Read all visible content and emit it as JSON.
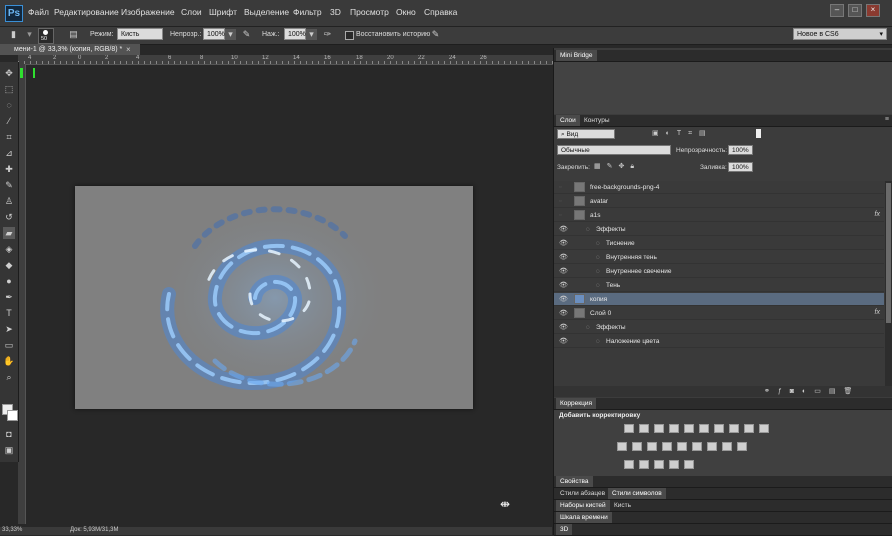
{
  "app": {
    "logo": "Ps",
    "menu": [
      "Файл",
      "Редактирование",
      "Изображение",
      "Слои",
      "Шрифт",
      "Выделение",
      "Фильтр",
      "3D",
      "Просмотр",
      "Окно",
      "Справка"
    ],
    "window_buttons": [
      "–",
      "□",
      "×"
    ]
  },
  "options_bar": {
    "brush_size": "50",
    "mode_label": "Режим:",
    "mode_value": "Кисть",
    "opacity_label": "Непрозр.:",
    "opacity_value": "100%",
    "pressure_label": "Наж.:",
    "pressure_value": "100%",
    "history_label": "Восстановить историю",
    "workspace_value": "Новое в CS6"
  },
  "document": {
    "tab_title": "мени-1 @ 33,3% (копия, RGB/8) *",
    "tab_close": "×",
    "ruler_numbers": [
      "4",
      "2",
      "0",
      "2",
      "4",
      "6",
      "8",
      "10",
      "12",
      "14",
      "16",
      "18",
      "20",
      "22",
      "24",
      "26"
    ]
  },
  "status": {
    "zoom": "33,33%",
    "doc_info": "Док: 5,93M/31,3M"
  },
  "panels": {
    "mini_bridge": {
      "title": "Mini Bridge"
    },
    "layers": {
      "tabs": [
        "Слои",
        "Контуры"
      ],
      "filter_value": "Вид",
      "blend_mode": "Обычные",
      "opacity_label": "Непрозрачность:",
      "opacity_value": "100%",
      "lock_label": "Закрепить:",
      "fill_label": "Заливка:",
      "fill_value": "100%",
      "rows": [
        {
          "name": "free-backgrounds-png-4",
          "indent": 0,
          "fx": false,
          "visible": false
        },
        {
          "name": "avatar",
          "indent": 0,
          "fx": false,
          "visible": false
        },
        {
          "name": "a1s",
          "indent": 0,
          "fx": true,
          "visible": false
        },
        {
          "name": "Эффекты",
          "indent": 1,
          "fx": false,
          "visible": true
        },
        {
          "name": "Тиснение",
          "indent": 2,
          "fx": false,
          "visible": true
        },
        {
          "name": "Внутренняя тень",
          "indent": 2,
          "fx": false,
          "visible": true
        },
        {
          "name": "Внутреннее свечение",
          "indent": 2,
          "fx": false,
          "visible": true
        },
        {
          "name": "Тень",
          "indent": 2,
          "fx": false,
          "visible": true
        },
        {
          "name": "копия",
          "indent": 0,
          "fx": false,
          "visible": true,
          "selected": true
        },
        {
          "name": "Слой 0",
          "indent": 0,
          "fx": true,
          "visible": true
        },
        {
          "name": "Эффекты",
          "indent": 1,
          "fx": false,
          "visible": true
        },
        {
          "name": "Наложение цвета",
          "indent": 2,
          "fx": false,
          "visible": true
        }
      ],
      "fx_symbol": "fx"
    },
    "adjustments": {
      "title": "Коррекция",
      "subtitle": "Добавить корректировку"
    },
    "properties": {
      "title": "Свойства"
    },
    "styles": {
      "tabs": [
        "Стили абзацев",
        "Стили символов"
      ]
    },
    "brushes": {
      "tabs": [
        "Наборы кистей",
        "Кисть"
      ]
    },
    "timeline": {
      "title": "Шкала времени"
    },
    "three_d": {
      "title": "3D"
    }
  },
  "colors": {
    "accent": "#5a6b80",
    "canvas_bg": "#808080",
    "swirl": "#5f9ee8"
  }
}
